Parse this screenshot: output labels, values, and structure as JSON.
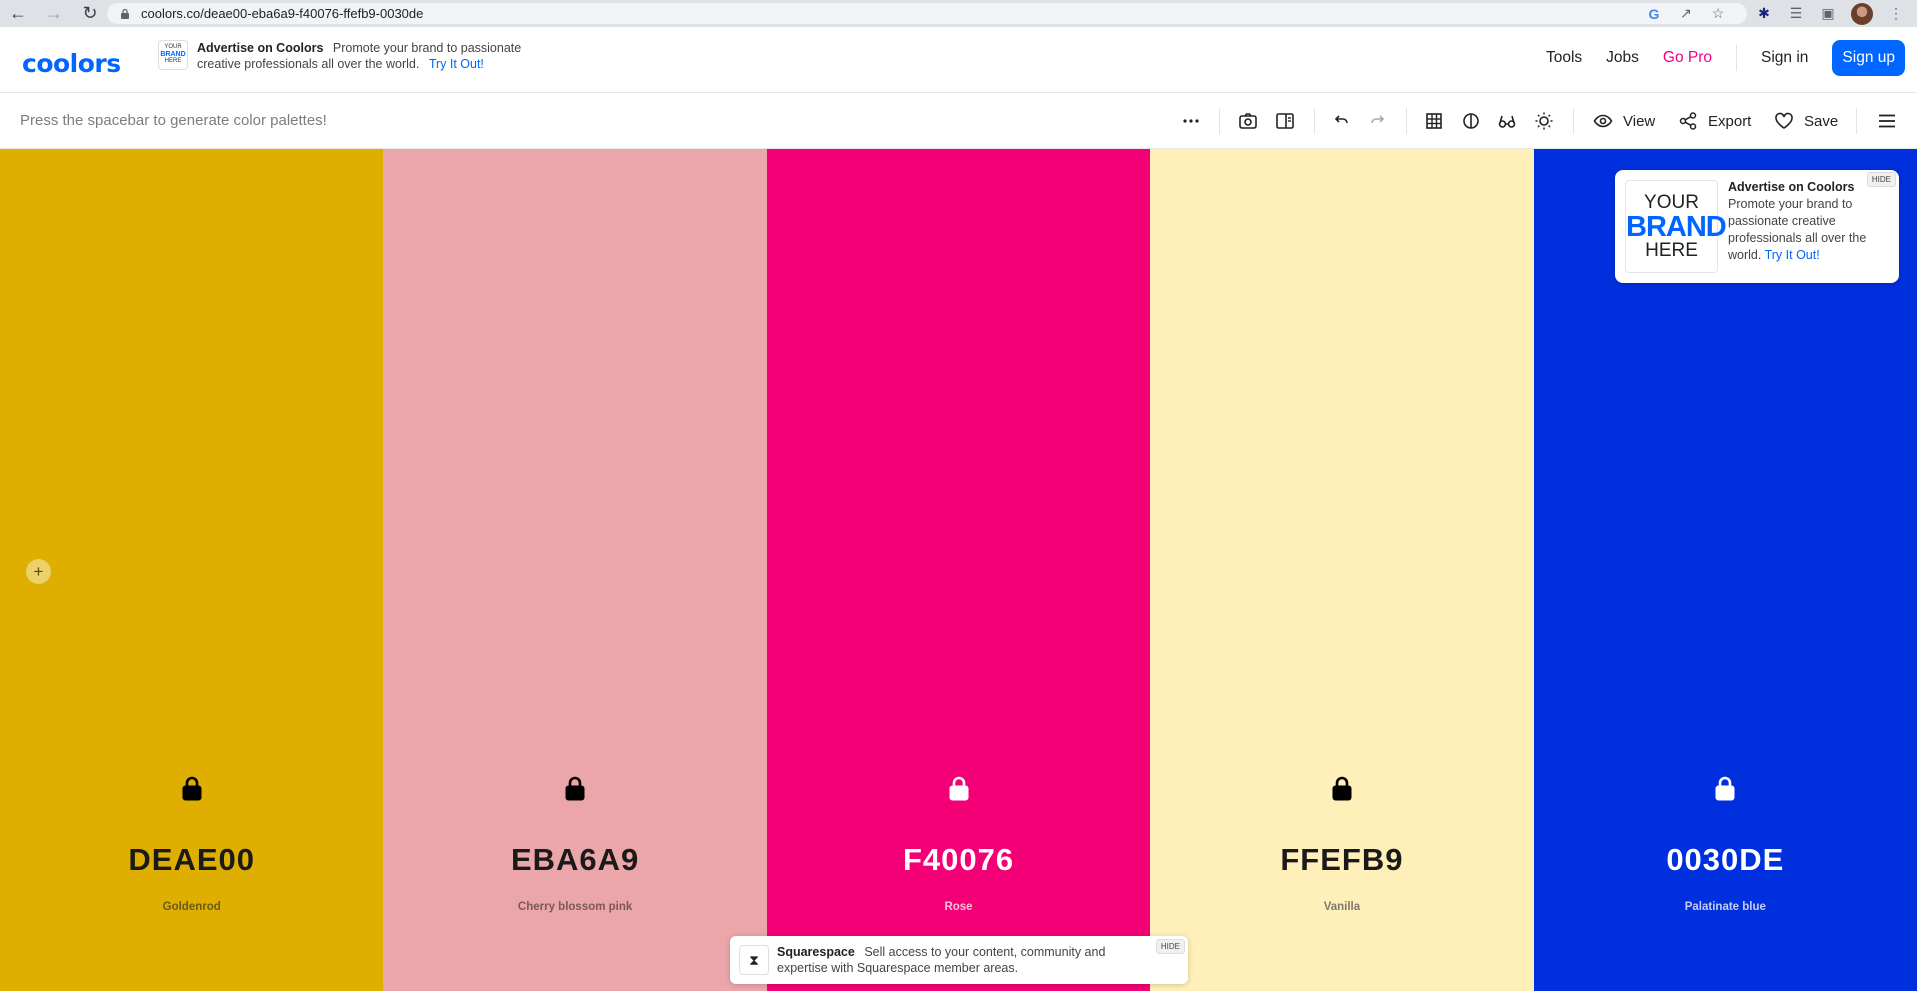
{
  "browser": {
    "url": "coolors.co/deae00-eba6a9-f40076-ffefb9-0030de"
  },
  "header": {
    "logo_text": "coolors",
    "ad": {
      "thumb_top": "YOUR",
      "thumb_brand": "BRAND",
      "thumb_bottom": "HERE",
      "title": "Advertise on Coolors",
      "text": "Promote your brand to passionate creative professionals all over the world.",
      "link": "Try It Out!"
    },
    "nav": {
      "tools": "Tools",
      "jobs": "Jobs",
      "go_pro": "Go Pro",
      "sign_in": "Sign in",
      "sign_up": "Sign up"
    }
  },
  "toolbar": {
    "hint": "Press the spacebar to generate color palettes!",
    "view": "View",
    "export": "Export",
    "save": "Save"
  },
  "palette": [
    {
      "hex": "DEAE00",
      "name": "Goldenrod",
      "color": "#deae00",
      "text_color": "#1a1a1a",
      "name_color": "#6d5a14"
    },
    {
      "hex": "EBA6A9",
      "name": "Cherry blossom pink",
      "color": "#eba6a9",
      "text_color": "#1a1a1a",
      "name_color": "#7d5758"
    },
    {
      "hex": "F40076",
      "name": "Rose",
      "color": "#f40076",
      "text_color": "#ffffff",
      "name_color": "#fbc2d9"
    },
    {
      "hex": "FFEFB9",
      "name": "Vanilla",
      "color": "#ffefb9",
      "text_color": "#1a1a1a",
      "name_color": "#80786a"
    },
    {
      "hex": "0030DE",
      "name": "Palatinate blue",
      "color": "#0030de",
      "text_color": "#ffffff",
      "name_color": "#c5cdf6"
    }
  ],
  "side_ad": {
    "brand_top": "YOUR",
    "brand_mid": "BRAND",
    "brand_bottom": "HERE",
    "title": "Advertise on Coolors",
    "text": "Promote your brand to passionate creative professionals all over the world.",
    "link": "Try It Out!",
    "hide": "HIDE"
  },
  "squarespace_ad": {
    "title": "Squarespace",
    "text": "Sell access to your content, community and expertise with Squarespace member areas.",
    "hide": "HIDE"
  }
}
